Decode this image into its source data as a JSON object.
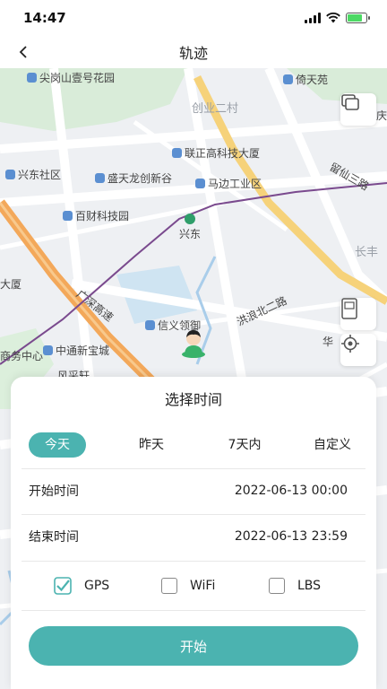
{
  "status_bar": {
    "time": "14:47"
  },
  "nav": {
    "title": "轨迹"
  },
  "map": {
    "labels": [
      {
        "text": "尖岗山壹号花园",
        "poi": true
      },
      {
        "text": "倚天苑",
        "poi": true
      },
      {
        "text": "创业二村",
        "poi": false
      },
      {
        "text": "庆",
        "poi": false
      },
      {
        "text": "联正高科技大厦",
        "poi": true
      },
      {
        "text": "兴东社区",
        "poi": true
      },
      {
        "text": "盛天龙创新谷",
        "poi": true
      },
      {
        "text": "马边工业区",
        "poi": true
      },
      {
        "text": "留仙三路",
        "poi": false
      },
      {
        "text": "百财科技园",
        "poi": true
      },
      {
        "text": "兴东",
        "poi": false
      },
      {
        "text": "长丰",
        "poi": false
      },
      {
        "text": "大厦",
        "poi": false
      },
      {
        "text": "广深高速",
        "poi": false
      },
      {
        "text": "洪浪北二路",
        "poi": false
      },
      {
        "text": "信义领御",
        "poi": true
      },
      {
        "text": "华",
        "poi": false
      },
      {
        "text": "中通新宝城",
        "poi": true
      },
      {
        "text": "商务中心",
        "poi": false
      },
      {
        "text": "风采轩",
        "poi": false
      }
    ],
    "controls": {
      "gps_label": "GPS"
    }
  },
  "sheet": {
    "title": "选择时间",
    "tabs": [
      {
        "label": "今天",
        "active": true
      },
      {
        "label": "昨天",
        "active": false
      },
      {
        "label": "7天内",
        "active": false
      },
      {
        "label": "自定义",
        "active": false
      }
    ],
    "start": {
      "label": "开始时间",
      "value": "2022-06-13 00:00"
    },
    "end": {
      "label": "结束时间",
      "value": "2022-06-13 23:59"
    },
    "sources": [
      {
        "label": "GPS",
        "checked": true
      },
      {
        "label": "WiFi",
        "checked": false
      },
      {
        "label": "LBS",
        "checked": false
      }
    ],
    "button_label": "开始"
  },
  "colors": {
    "accent": "#4bb3b0",
    "road_orange": "#f3a85a",
    "metro": "#7a4a8e"
  }
}
